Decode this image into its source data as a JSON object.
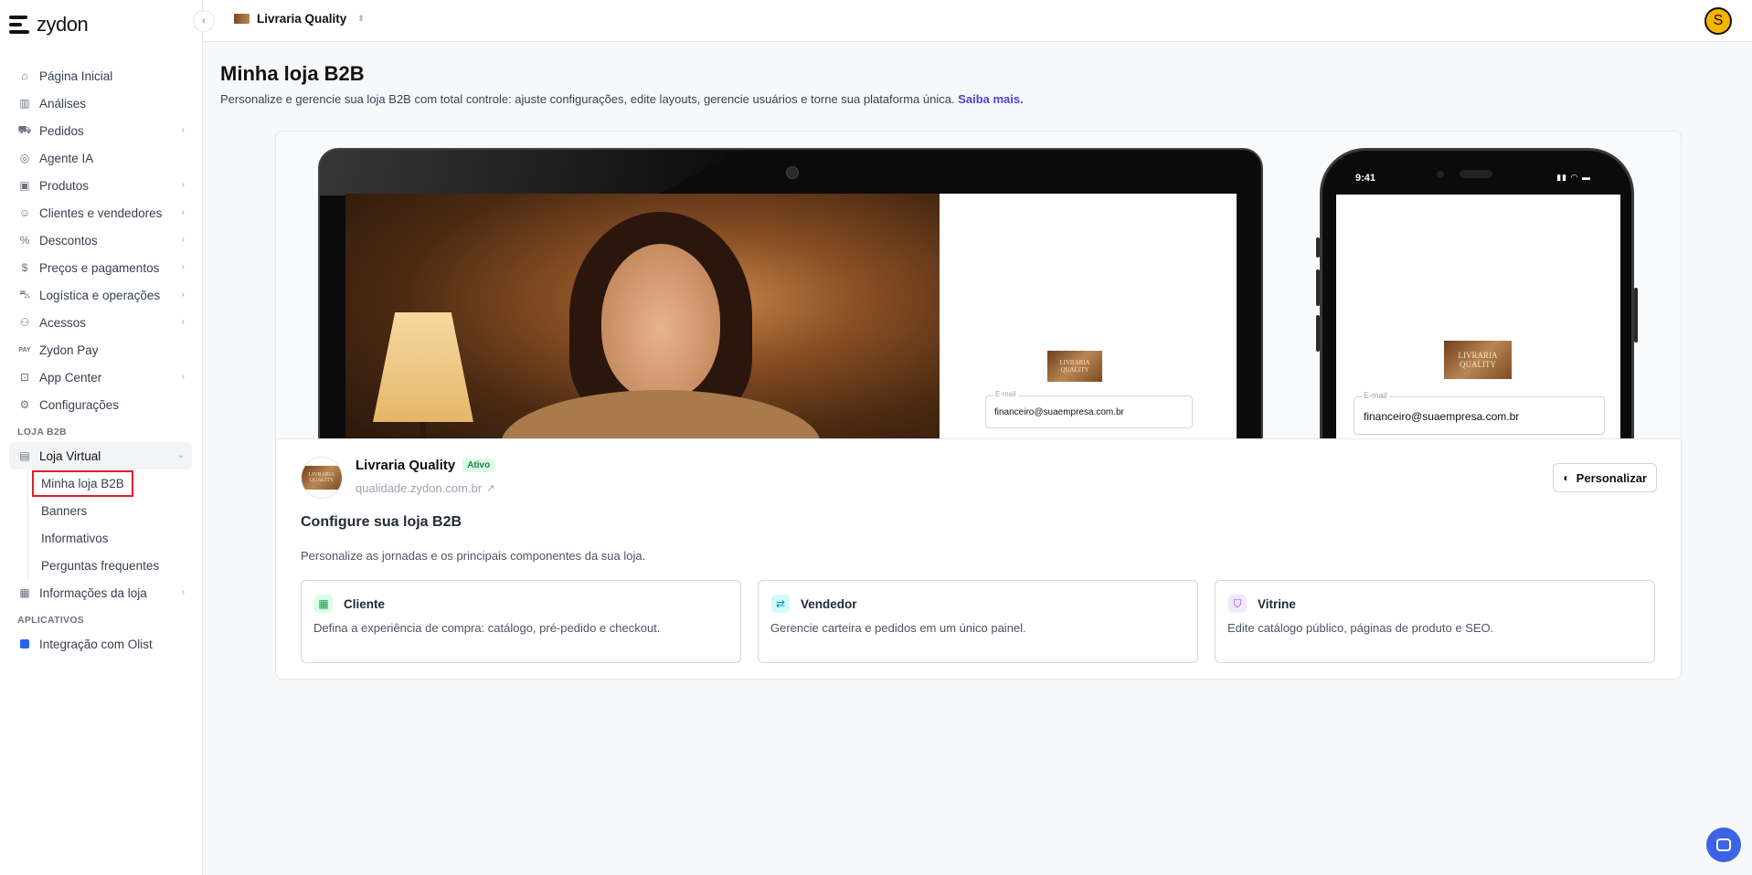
{
  "brand": {
    "name": "zydon"
  },
  "topbar": {
    "store_name": "Livraria Quality",
    "avatar_letter": "S"
  },
  "sidebar": {
    "items": [
      {
        "label": "Página Inicial",
        "icon": "home-icon",
        "chevron": false
      },
      {
        "label": "Análises",
        "icon": "bar-chart-icon",
        "chevron": false
      },
      {
        "label": "Pedidos",
        "icon": "cart-icon",
        "chevron": true
      },
      {
        "label": "Agente IA",
        "icon": "ai-agent-icon",
        "chevron": false
      },
      {
        "label": "Produtos",
        "icon": "box-icon",
        "chevron": true
      },
      {
        "label": "Clientes e vendedores",
        "icon": "users-icon",
        "chevron": true
      },
      {
        "label": "Descontos",
        "icon": "discount-icon",
        "chevron": true
      },
      {
        "label": "Preços e pagamentos",
        "icon": "dollar-icon",
        "chevron": true
      },
      {
        "label": "Logística e operações",
        "icon": "truck-icon",
        "chevron": true
      },
      {
        "label": "Acessos",
        "icon": "access-icon",
        "chevron": true
      },
      {
        "label": "Zydon Pay",
        "icon": "pay-icon",
        "chevron": false
      },
      {
        "label": "App Center",
        "icon": "app-center-icon",
        "chevron": true
      },
      {
        "label": "Configurações",
        "icon": "gear-icon",
        "chevron": false
      }
    ],
    "section_b2b": "LOJA B2B",
    "loja_virtual": "Loja Virtual",
    "sub_items": [
      "Minha loja B2B",
      "Banners",
      "Informativos",
      "Perguntas frequentes"
    ],
    "informacoes": "Informações da loja",
    "section_apps": "APLICATIVOS",
    "integracao": "Integração com Olist"
  },
  "main": {
    "title": "Minha loja B2B",
    "description": "Personalize e gerencie sua loja B2B com total controle: ajuste configurações, edite layouts, gerencie usuários e torne sua plataforma única.",
    "learn_more": "Saiba mais.",
    "preview": {
      "email_label": "E-mail",
      "email_value": "financeiro@suaempresa.com.br",
      "phone_time": "9:41",
      "logo_text": "LIVRARIA QUALITY"
    },
    "store": {
      "name": "Livraria Quality",
      "status": "Ativo",
      "url": "qualidade.zydon.com.br",
      "customize_label": "Personalizar"
    },
    "configure": {
      "title": "Configure sua loja B2B",
      "description": "Personalize as jornadas e os principais componentes da sua loja.",
      "tiles": [
        {
          "title": "Cliente",
          "description": "Defina a experiência de compra: catálogo, pré-pedido e checkout.",
          "color": "#16a34a",
          "bg": "#dcfce7"
        },
        {
          "title": "Vendedor",
          "description": "Gerencie carteira e pedidos em um único painel.",
          "color": "#0891b2",
          "bg": "#cffafe"
        },
        {
          "title": "Vitrine",
          "description": "Edite catálogo público, páginas de produto e SEO.",
          "color": "#9333ea",
          "bg": "#f3e8ff"
        }
      ]
    }
  }
}
